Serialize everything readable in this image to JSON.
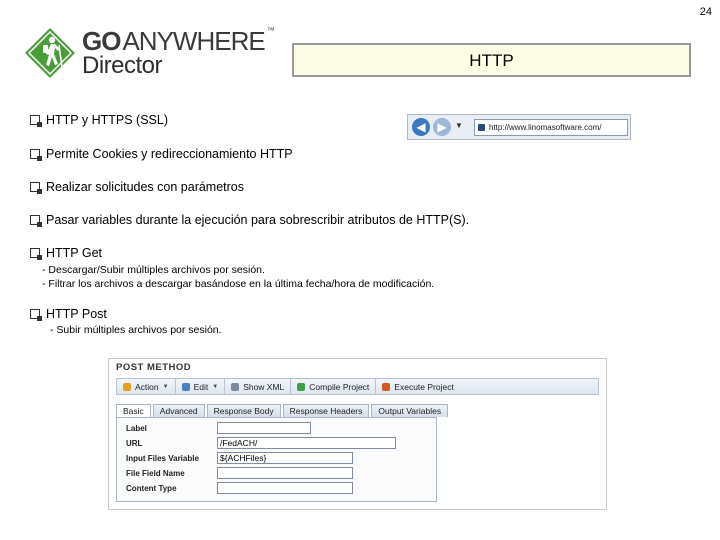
{
  "page_number": "24",
  "logo": {
    "line1_go": "GO",
    "line1_rest": "ANYWHERE",
    "trademark": "™",
    "line2": "Director",
    "green": "#4a9b3a"
  },
  "title": "HTTP",
  "bullets": [
    {
      "text": "HTTP y HTTPS (SSL)"
    },
    {
      "text": "Permite Cookies y redireccionamiento HTTP"
    },
    {
      "text": "Realizar solicitudes con parámetros"
    },
    {
      "text": "Pasar variables durante la ejecución para sobrescribir atributos de HTTP(S)."
    },
    {
      "text": "HTTP Get"
    },
    {
      "text": "HTTP Post"
    }
  ],
  "get_subitems": [
    "- Descargar/Subir múltiples archivos por sesión.",
    "- Filtrar los archivos a descargar basándose en la última fecha/hora de modificación."
  ],
  "post_subitems": [
    "- Subir múltiples archivos por sesión."
  ],
  "browser": {
    "back_glyph": "◀",
    "forward_glyph": "▶",
    "dropdown_glyph": "▼",
    "address": "http://www.linomasoftware.com/"
  },
  "post_panel": {
    "title": "POST METHOD",
    "toolbar": [
      {
        "label": "Action",
        "icon": "action-icon",
        "color": "#e0a020",
        "has_menu": true
      },
      {
        "label": "Edit",
        "icon": "edit-icon",
        "color": "#4a7fc0",
        "has_menu": true
      },
      {
        "label": "Show XML",
        "icon": "xml-icon",
        "color": "#7a8aa0",
        "has_menu": false
      },
      {
        "label": "Compile Project",
        "icon": "compile-icon",
        "color": "#3f9e4a",
        "has_menu": false
      },
      {
        "label": "Execute Project",
        "icon": "execute-icon",
        "color": "#d05a20",
        "has_menu": false
      }
    ],
    "tabs": [
      "Basic",
      "Advanced",
      "Response Body",
      "Response Headers",
      "Output Variables"
    ],
    "active_tab": "Basic",
    "fields": [
      {
        "label": "Label",
        "value": ""
      },
      {
        "label": "URL",
        "value": "/FedACH/"
      },
      {
        "label": "Input Files Variable",
        "value": "${ACHFiles}"
      },
      {
        "label": "File Field Name",
        "value": ""
      },
      {
        "label": "Content Type",
        "value": ""
      }
    ]
  }
}
